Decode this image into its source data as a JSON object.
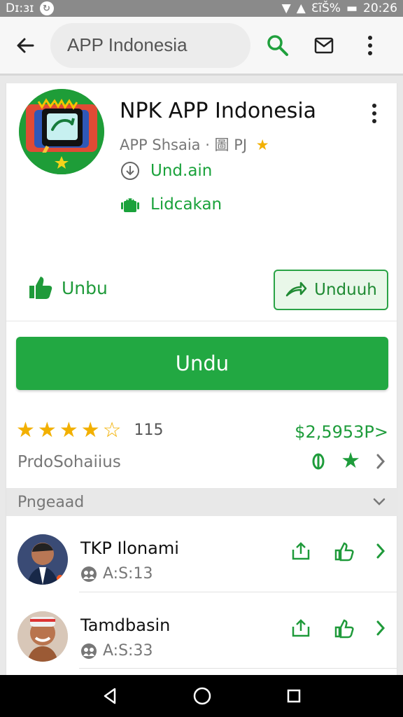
{
  "status": {
    "left_time": "Dɪ:ɜɪ",
    "right_battery": "ƐĩŠ%",
    "right_time": "20:26"
  },
  "search": {
    "value": "APP Indonesia"
  },
  "app": {
    "title": "NPK APP Indonesia",
    "meta": "APP Shsaia · 圖 PJ",
    "download_label": "Und.ain",
    "location_label": "Lidcakan",
    "like_label": "Unbu",
    "outline_button": "Unduuh",
    "primary_button": "Undu"
  },
  "rating": {
    "count": "115",
    "price": "$2,5953P>",
    "provider": "PrdoSohaiius"
  },
  "section": {
    "title": "Pngeaad"
  },
  "contacts": [
    {
      "name": "TKP Ilonami",
      "subtitle": "A:S:13"
    },
    {
      "name": "Tamdbasin",
      "subtitle": "A:S:33"
    }
  ],
  "colors": {
    "accent": "#22a842",
    "status_gray": "#8a8a8a",
    "star": "#f2b000"
  }
}
